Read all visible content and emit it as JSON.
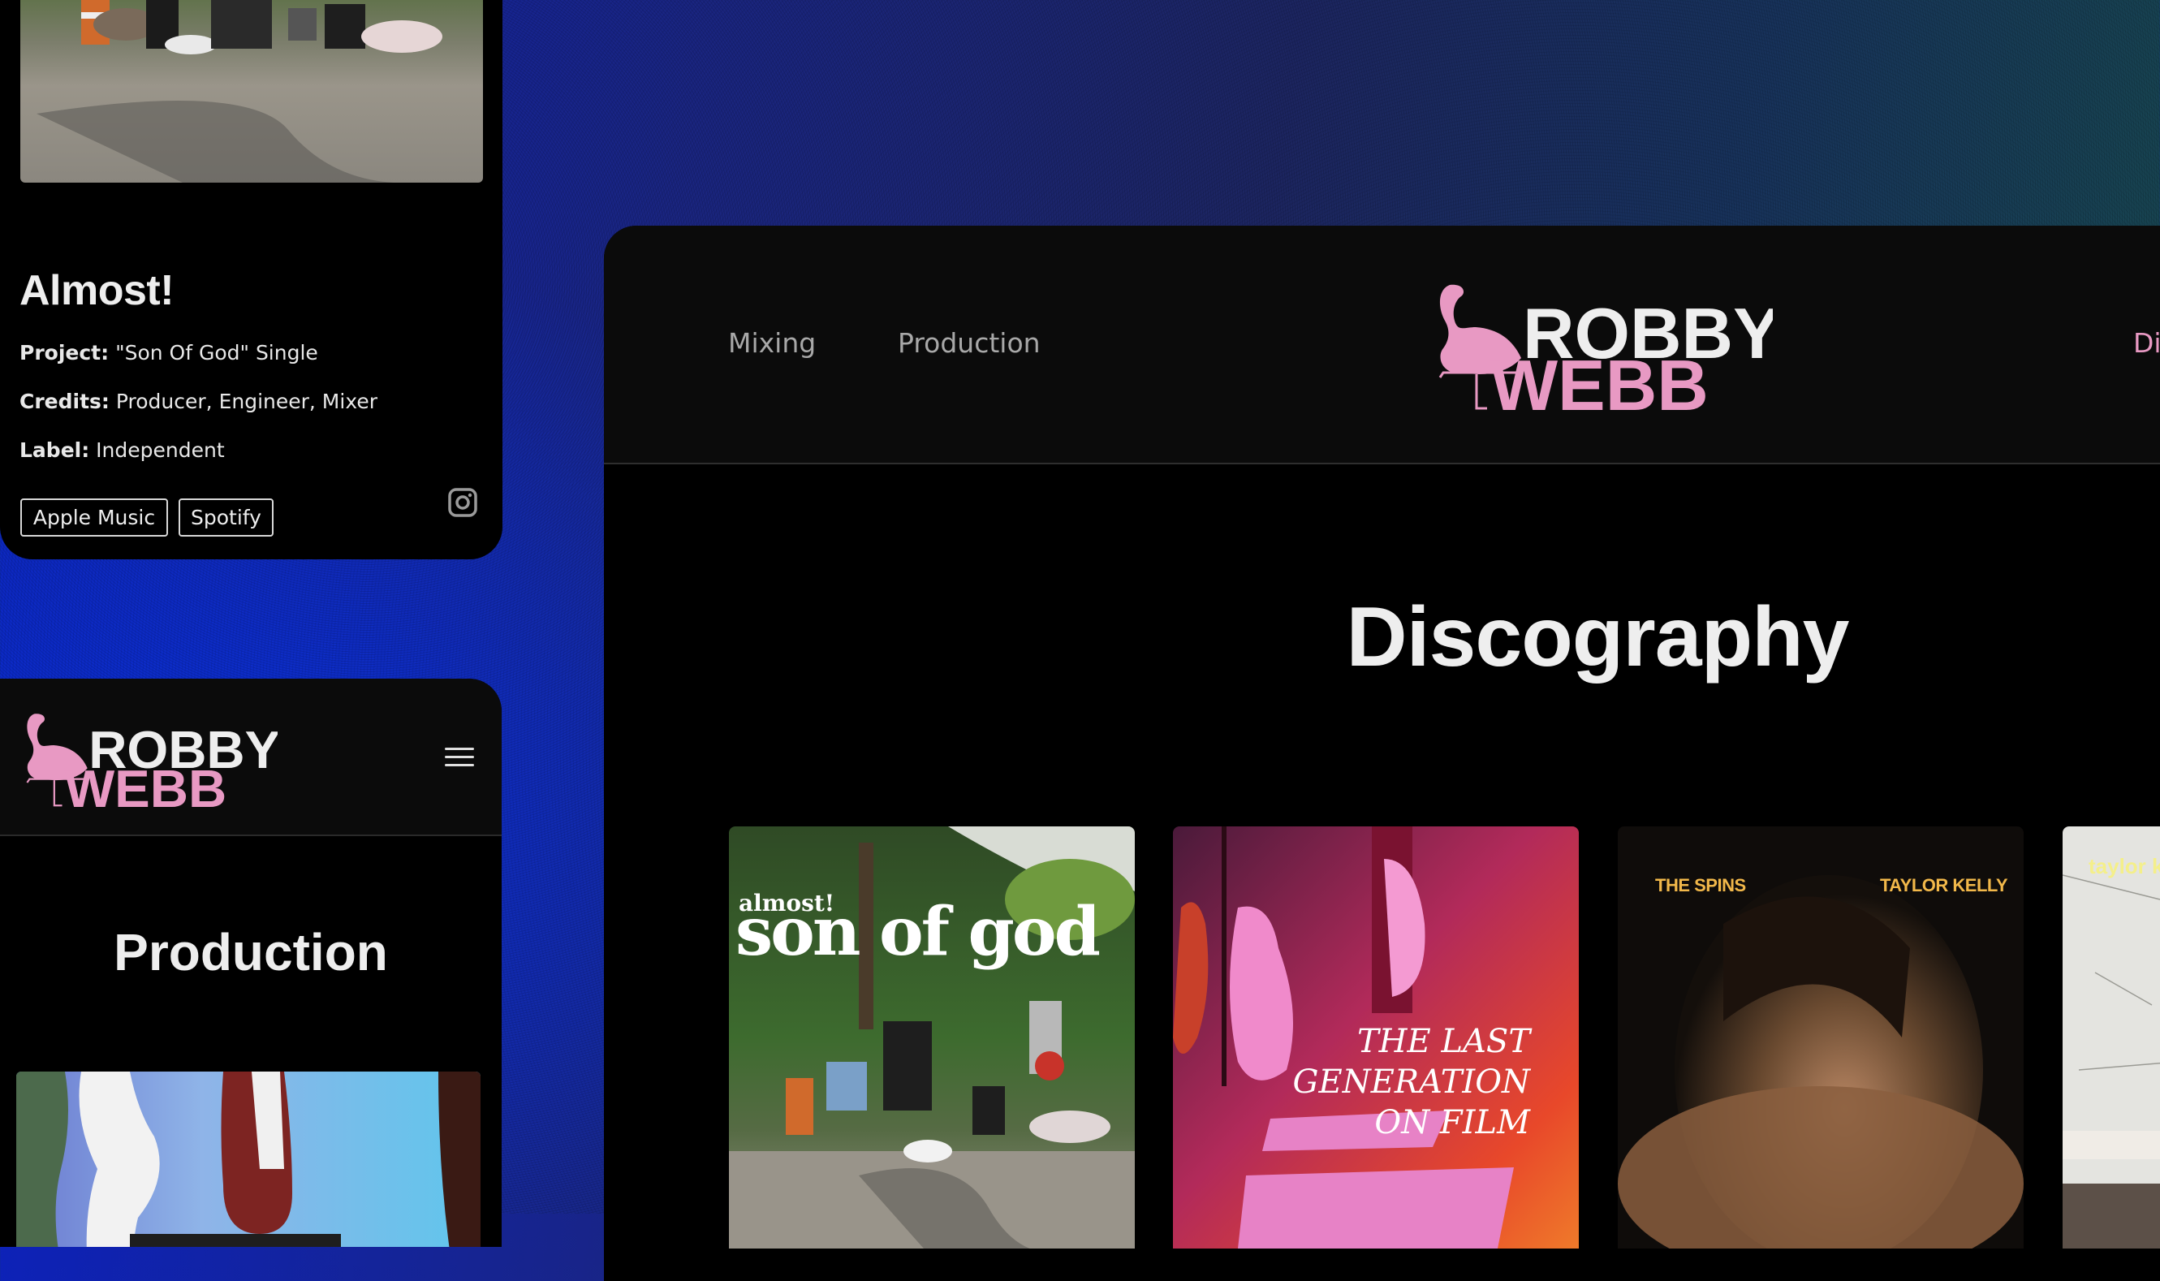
{
  "brand": {
    "line1": "ROBBY",
    "line2": "WEBB",
    "pink": "#e899c3",
    "white": "#eeeeee"
  },
  "mobile_project_card": {
    "title": "Almost!",
    "rows": [
      {
        "label": "Project:",
        "value": "\"Son Of God\" Single"
      },
      {
        "label": "Credits:",
        "value": "Producer, Engineer, Mixer"
      },
      {
        "label": "Label:",
        "value": "Independent"
      }
    ],
    "buttons": [
      "Apple Music",
      "Spotify"
    ],
    "social_icon": "instagram-icon"
  },
  "mobile_page_card": {
    "menu_icon": "hamburger-icon",
    "heading": "Production"
  },
  "desktop": {
    "nav": [
      {
        "label": "Mixing",
        "active": false
      },
      {
        "label": "Production",
        "active": false
      },
      {
        "label": "Di",
        "active": true
      }
    ],
    "heading": "Discography",
    "albums": [
      {
        "artist": "almost!",
        "title": "son of god"
      },
      {
        "artist": "",
        "title_lines": [
          "THE LAST",
          "GENERATION",
          "ON FILM"
        ]
      },
      {
        "left": "THE SPINS",
        "right": "TAYLOR KELLY"
      },
      {
        "text": "taylor k"
      }
    ]
  }
}
